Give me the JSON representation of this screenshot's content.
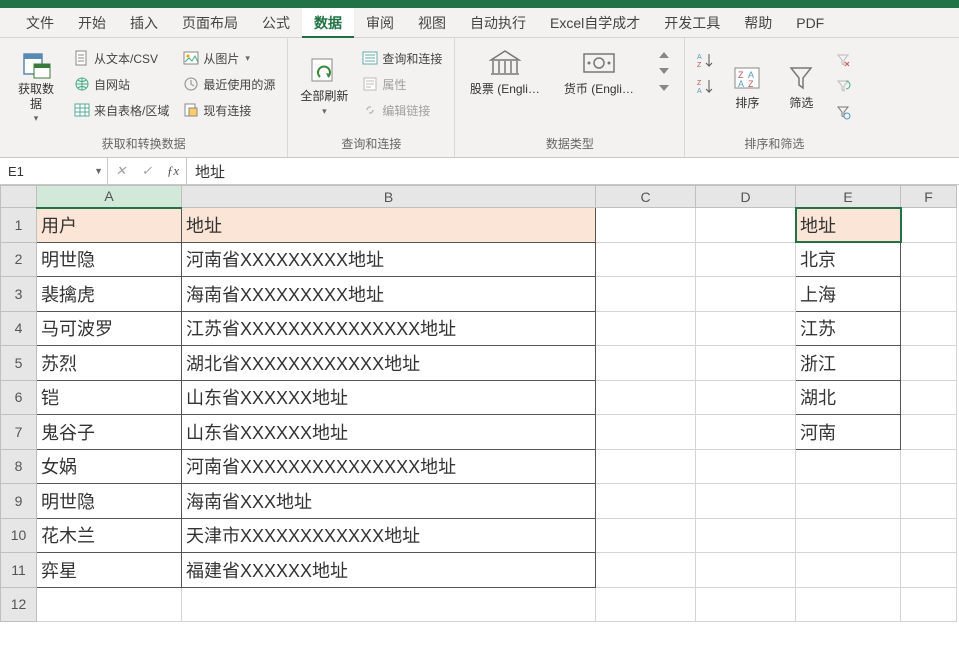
{
  "tabs": [
    "文件",
    "开始",
    "插入",
    "页面布局",
    "公式",
    "数据",
    "审阅",
    "视图",
    "自动执行",
    "Excel自学成才",
    "开发工具",
    "帮助",
    "PDF"
  ],
  "active_tab": 5,
  "ribbon": {
    "g1": {
      "big": "获取数\n据",
      "items": [
        "从文本/CSV",
        "自网站",
        "来自表格/区域",
        "从图片",
        "最近使用的源",
        "现有连接"
      ],
      "label": "获取和转换数据"
    },
    "g2": {
      "big": "全部刷新",
      "items": [
        "查询和连接",
        "属性",
        "编辑链接"
      ],
      "label": "查询和连接"
    },
    "g3": {
      "items": [
        "股票 (Engli…",
        "货币 (Engli…"
      ],
      "label": "数据类型"
    },
    "g4": {
      "big": "排序",
      "big2": "筛选",
      "label": "排序和筛选"
    }
  },
  "name_box": "E1",
  "formula": "地址",
  "columns": [
    "A",
    "B",
    "C",
    "D",
    "E",
    "F"
  ],
  "rows": [
    {
      "n": 1,
      "A": "用户",
      "B": "地址",
      "E": "地址",
      "hdr": true
    },
    {
      "n": 2,
      "A": "明世隐",
      "B": "河南省XXXXXXXXX地址",
      "E": "北京"
    },
    {
      "n": 3,
      "A": "裴擒虎",
      "B": "海南省XXXXXXXXX地址",
      "E": "上海"
    },
    {
      "n": 4,
      "A": "马可波罗",
      "B": "江苏省XXXXXXXXXXXXXXX地址",
      "E": "江苏"
    },
    {
      "n": 5,
      "A": "苏烈",
      "B": "湖北省XXXXXXXXXXXX地址",
      "E": "浙江"
    },
    {
      "n": 6,
      "A": "铠",
      "B": "山东省XXXXXX地址",
      "E": "湖北"
    },
    {
      "n": 7,
      "A": "鬼谷子",
      "B": "山东省XXXXXX地址",
      "E": "河南"
    },
    {
      "n": 8,
      "A": "女娲",
      "B": "河南省XXXXXXXXXXXXXXX地址",
      "E": ""
    },
    {
      "n": 9,
      "A": "明世隐",
      "B": "海南省XXX地址",
      "E": ""
    },
    {
      "n": 10,
      "A": "花木兰",
      "B": "天津市XXXXXXXXXXXX地址",
      "E": ""
    },
    {
      "n": 11,
      "A": "弈星",
      "B": "福建省XXXXXX地址",
      "E": ""
    }
  ],
  "selected_cell": "E1"
}
